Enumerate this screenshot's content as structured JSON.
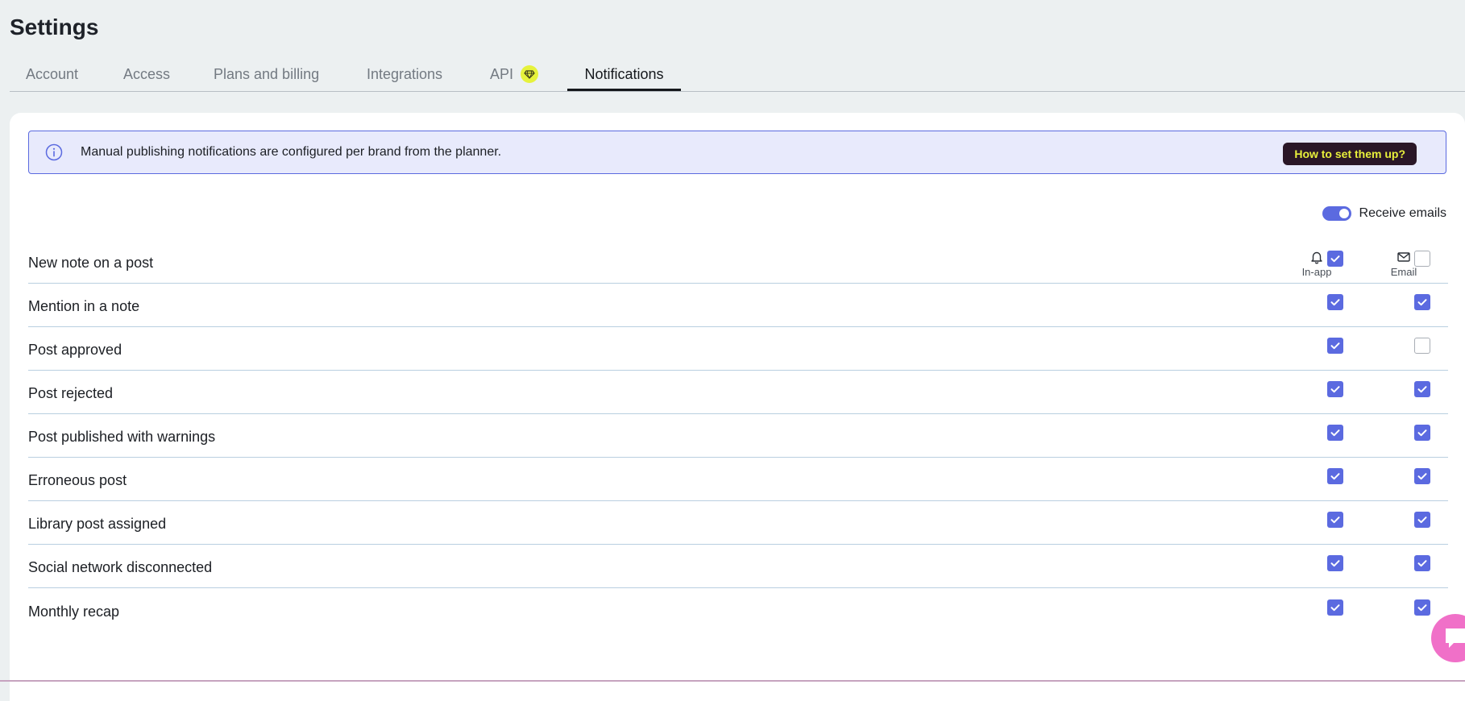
{
  "page": {
    "title": "Settings"
  },
  "tabs": [
    {
      "label": "Account",
      "active": false
    },
    {
      "label": "Access",
      "active": false
    },
    {
      "label": "Plans and billing",
      "active": false
    },
    {
      "label": "Integrations",
      "active": false
    },
    {
      "label": "API",
      "active": false,
      "badge_icon": "gem-icon"
    },
    {
      "label": "Notifications",
      "active": true
    }
  ],
  "banner": {
    "icon": "info-icon",
    "text": "Manual publishing notifications are configured per brand from the planner.",
    "button_label": "How to set them up?"
  },
  "receive_emails": {
    "label": "Receive emails",
    "enabled": true
  },
  "columns": [
    {
      "label": "In-app",
      "icon": "bell-icon"
    },
    {
      "label": "Email",
      "icon": "mail-icon"
    }
  ],
  "notifications": [
    {
      "label": "New note on a post",
      "in_app": true,
      "email": false
    },
    {
      "label": "Mention in a note",
      "in_app": true,
      "email": true
    },
    {
      "label": "Post approved",
      "in_app": true,
      "email": false
    },
    {
      "label": "Post rejected",
      "in_app": true,
      "email": true
    },
    {
      "label": "Post published with warnings",
      "in_app": true,
      "email": true
    },
    {
      "label": "Erroneous post",
      "in_app": true,
      "email": true
    },
    {
      "label": "Library post assigned",
      "in_app": true,
      "email": true
    },
    {
      "label": "Social network disconnected",
      "in_app": true,
      "email": true
    },
    {
      "label": "Monthly recap",
      "in_app": true,
      "email": true
    }
  ],
  "colors": {
    "accent": "#5b6ae0",
    "banner_bg": "#e8eafc",
    "button_bg": "#2a1727",
    "button_text": "#e8f03b",
    "chat_bubble": "#f070c8"
  }
}
